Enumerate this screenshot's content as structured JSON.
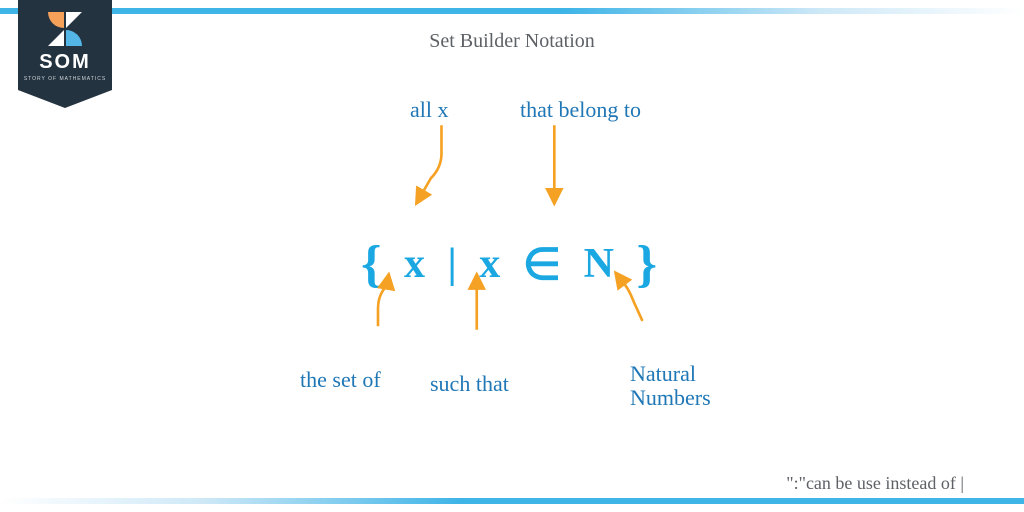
{
  "logo": {
    "acronym": "SOM",
    "subtitle": "STORY OF MATHEMATICS"
  },
  "title": "Set Builder Notation",
  "formula": {
    "open_brace": "{",
    "var1": "x",
    "bar": "|",
    "var2": "x",
    "member": "∈",
    "set": "N",
    "close_brace": "}"
  },
  "labels": {
    "all_x": "all x",
    "belong": "that belong to",
    "set_of": "the set of",
    "such_that": "such that",
    "natural": "Natural\nNumbers"
  },
  "footnote": "\":\"can be use instead of |",
  "colors": {
    "accent": "#1ba8e2",
    "label_blue": "#1f77b6",
    "arrow": "#f5a124"
  }
}
